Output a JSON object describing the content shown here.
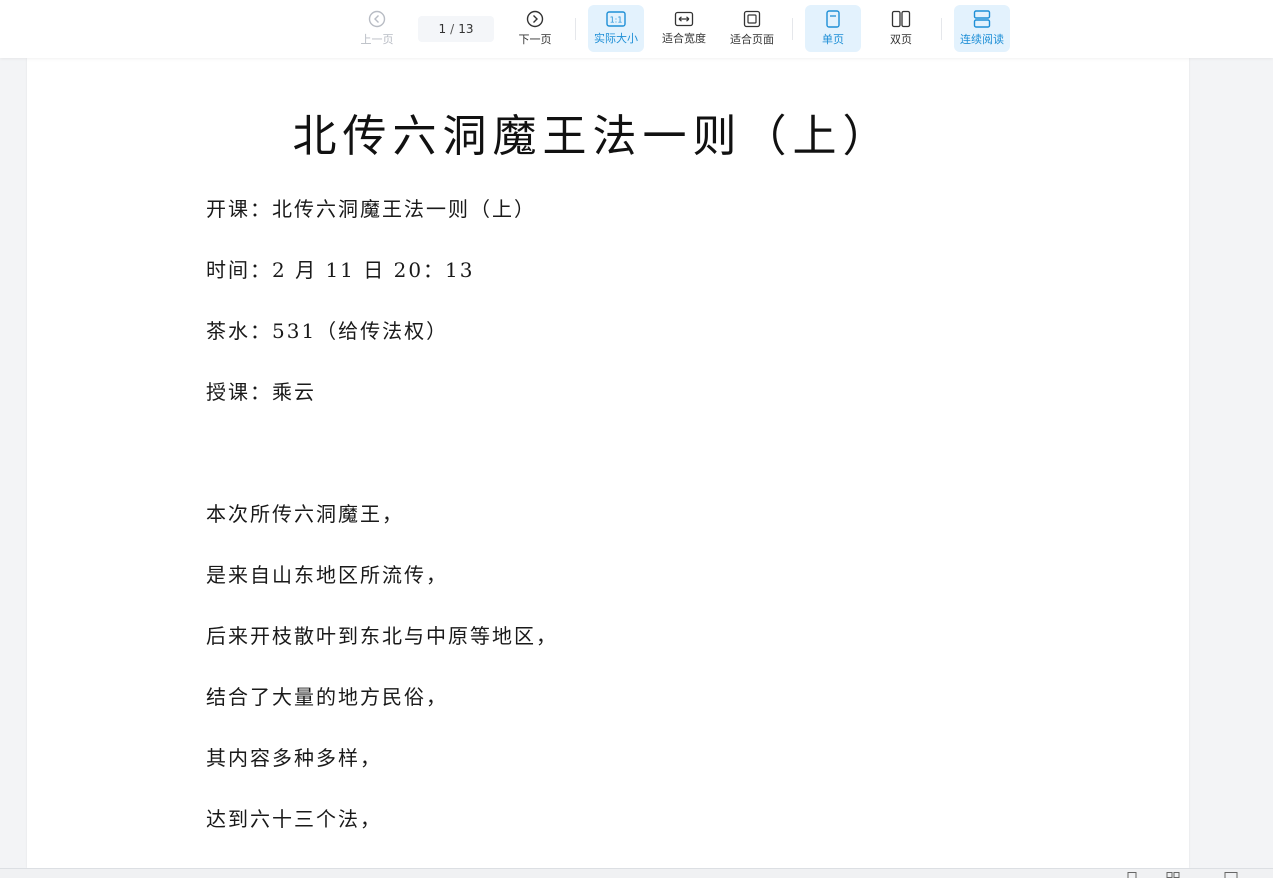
{
  "toolbar": {
    "prev_label": "上一页",
    "next_label": "下一页",
    "current_page": "1",
    "separator": "/",
    "total_pages": "13",
    "actual_size_label": "实际大小",
    "fit_width_label": "适合宽度",
    "fit_page_label": "适合页面",
    "single_page_label": "单页",
    "double_page_label": "双页",
    "continuous_label": "连续阅读",
    "actual_size_glyph": "1:1"
  },
  "colors": {
    "accent": "#1e8fd6",
    "active_bg": "#e3f2fd",
    "disabled": "#b8bcc4"
  },
  "document": {
    "title": "北传六洞魔王法一则（上）",
    "lines": [
      "开课：北传六洞魔王法一则（上）",
      "时间：2 月 11 日 20：13",
      "茶水：531（给传法权）",
      "授课：乘云",
      "本次所传六洞魔王，",
      "是来自山东地区所流传，",
      "后来开枝散叶到东北与中原等地区，",
      "结合了大量的地方民俗，",
      "其内容多种多样，",
      "达到六十三个法，"
    ]
  }
}
